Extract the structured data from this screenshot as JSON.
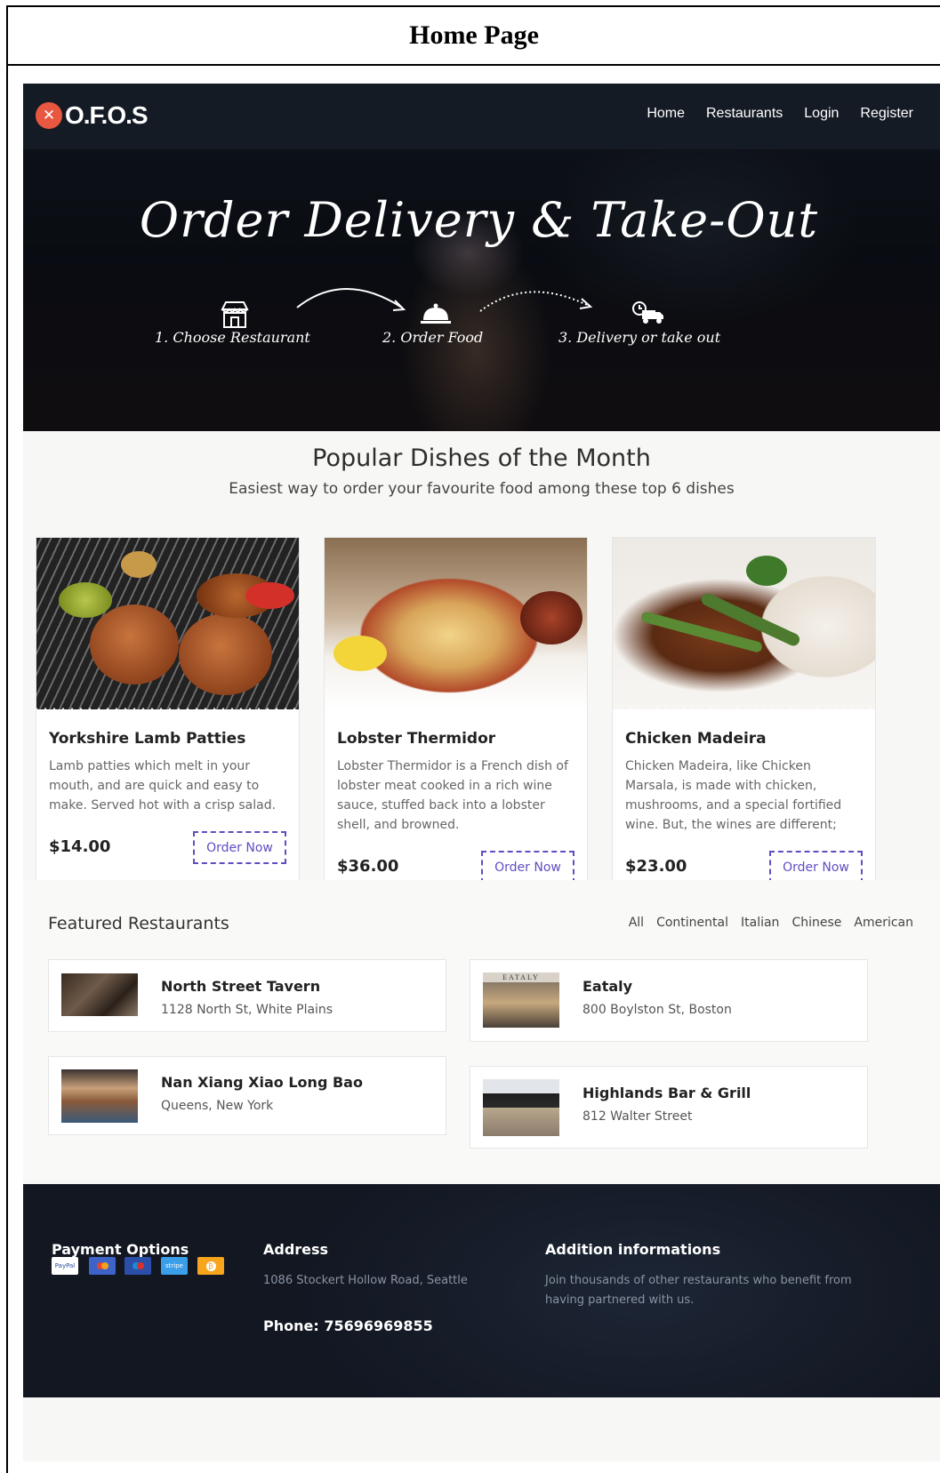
{
  "caption": "Home Page",
  "brand": {
    "logo_text": "O.F.O.S",
    "logo_glyph": "✕"
  },
  "nav": {
    "items": [
      "Home",
      "Restaurants",
      "Login",
      "Register"
    ]
  },
  "hero": {
    "title": "Order Delivery & Take-Out",
    "steps": [
      {
        "label": "1. Choose Restaurant",
        "icon": "store-icon"
      },
      {
        "label": "2. Order Food",
        "icon": "cloche-icon"
      },
      {
        "label": "3. Delivery or take out",
        "icon": "delivery-truck-icon"
      }
    ]
  },
  "popular": {
    "title": "Popular Dishes of the Month",
    "subtitle": "Easiest way to order your favourite food among these top 6 dishes",
    "button_label": "Order Now",
    "dishes": [
      {
        "name": "Yorkshire Lamb Patties",
        "description": "Lamb patties which melt in your mouth, and are quick and easy to make. Served hot with a crisp salad.",
        "price": "$14.00"
      },
      {
        "name": "Lobster Thermidor",
        "description": "Lobster Thermidor is a French dish of lobster meat cooked in a rich wine sauce, stuffed back into a lobster shell, and browned.",
        "price": "$36.00"
      },
      {
        "name": "Chicken Madeira",
        "description": "Chicken Madeira, like Chicken Marsala, is made with chicken, mushrooms, and a special fortified wine. But, the wines are different;",
        "price": "$23.00"
      }
    ]
  },
  "featured": {
    "title": "Featured Restaurants",
    "filters": [
      "All",
      "Continental",
      "Italian",
      "Chinese",
      "American"
    ],
    "restaurants": [
      {
        "name": "North Street Tavern",
        "address": "1128 North St, White Plains"
      },
      {
        "name": "Eataly",
        "address": "800 Boylston St, Boston",
        "sign": "EATALY"
      },
      {
        "name": "Nan Xiang Xiao Long Bao",
        "address": "Queens, New York"
      },
      {
        "name": "Highlands Bar & Grill",
        "address": "812 Walter Street"
      }
    ]
  },
  "footer": {
    "payment_title": "Payment Options",
    "payment_methods": [
      {
        "name": "paypal-icon",
        "label": "PayPal",
        "color": "#ffffff"
      },
      {
        "name": "mastercard-icon",
        "label": "",
        "color": "#3d63c9"
      },
      {
        "name": "maestro-icon",
        "label": "",
        "color": "#2b4ea8"
      },
      {
        "name": "stripe-icon",
        "label": "stripe",
        "color": "#3a9ee8"
      },
      {
        "name": "bitcoin-icon",
        "label": "",
        "color": "#f6a51c"
      }
    ],
    "address_title": "Address",
    "address": "1086 Stockert Hollow Road, Seattle",
    "phone": "Phone: 75696969855",
    "info_title": "Addition informations",
    "info_text": "Join thousands of other restaurants who benefit from having partnered with us."
  },
  "colors": {
    "accent": "#5f4ec2",
    "brand": "#e8573f",
    "dark": "#161c28"
  }
}
